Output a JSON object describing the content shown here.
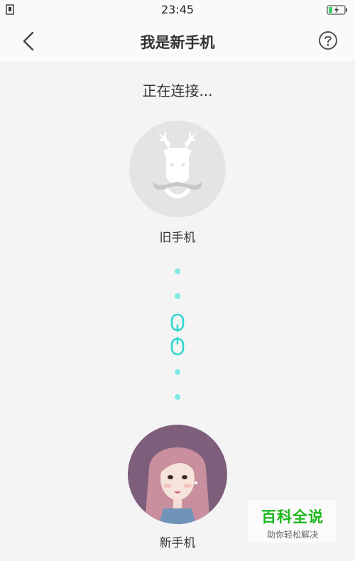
{
  "status_bar": {
    "time": "23:45"
  },
  "nav": {
    "title": "我是新手机"
  },
  "main": {
    "status_text": "正在连接...",
    "old_phone_label": "旧手机",
    "new_phone_label": "新手机"
  },
  "watermark": {
    "title": "百科全说",
    "subtitle": "助你轻松解决"
  },
  "icons": {
    "back": "chevron-left-icon",
    "help": "question-circle-icon",
    "link": "link-icon",
    "battery": "battery-charging-icon",
    "sim": "sim-card-icon"
  },
  "colors": {
    "accent": "#2fd6d0",
    "dots": "#7fe9e6",
    "watermark": "#1ab71a"
  }
}
